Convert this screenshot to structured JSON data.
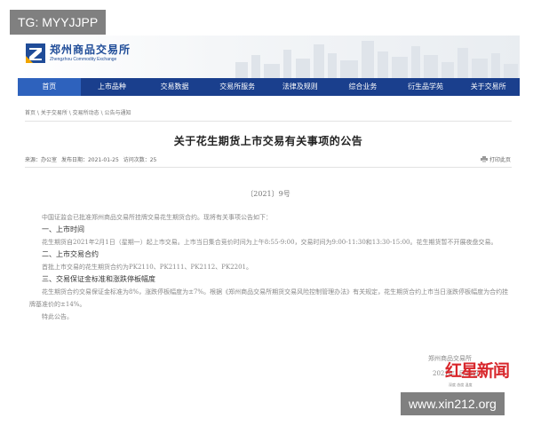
{
  "watermark_top": "TG: MYYJJPP",
  "watermark_bottom": "www.xin212.org",
  "logo": {
    "name": "郑州商品交易所",
    "english": "Zhengzhou Commodity Exchange"
  },
  "colors": {
    "nav_bg": "#1a3f8d",
    "nav_active": "#2e62bd",
    "brand_blue": "#1f4c98",
    "watermark_red": "#d8262b"
  },
  "nav": {
    "items": [
      {
        "label": "首页",
        "active": true
      },
      {
        "label": "上市品种",
        "active": false
      },
      {
        "label": "交易数据",
        "active": false
      },
      {
        "label": "交易所服务",
        "active": false
      },
      {
        "label": "法律及规则",
        "active": false
      },
      {
        "label": "综合业务",
        "active": false
      },
      {
        "label": "衍生品学苑",
        "active": false
      },
      {
        "label": "关于交易所",
        "active": false
      }
    ]
  },
  "breadcrumb": "首页 \\ 关于交易所 \\ 交易所动态 \\ 公告与通知",
  "article": {
    "title": "关于花生期货上市交易有关事项的公告",
    "meta": {
      "source": "来源：办公室",
      "publish_date": "发布日期：2021-01-25",
      "views": "访问次数：25"
    },
    "print_label": "打印此页",
    "doc_number": "〔2021〕9号",
    "intro": "中国证监会已批准郑州商品交易所挂牌交易花生期货合约。现将有关事项公告如下：",
    "sections": [
      {
        "heading": "一、上市时间",
        "paragraphs": [
          "花生期货自2021年2月1日（星期一）起上市交易。上市当日集合竞价时间为上午8:55-9:00，交易时间为9:00-11:30和13:30-15:00。花生期货暂不开展夜盘交易。"
        ]
      },
      {
        "heading": "二、上市交易合约",
        "paragraphs": [
          "首批上市交易的花生期货合约为PK2110、PK2111、PK2112、PK2201。"
        ]
      },
      {
        "heading": "三、交易保证金标准和涨跌停板幅度",
        "paragraphs": [
          "花生期货合约交易保证金标准为8%，涨跌停板幅度为±7%。根据《郑州商品交易所期货交易风险控制管理办法》有关规定，花生期货合约上市当日涨跌停板幅度为合约挂牌基准价的±14%。",
          "特此公告。"
        ]
      }
    ],
    "signature_org": "郑州商品交易所",
    "signature_date": "2021年1月25日"
  },
  "news_watermark": {
    "brand": "红星新闻",
    "sub": "深度 态度 温度"
  }
}
